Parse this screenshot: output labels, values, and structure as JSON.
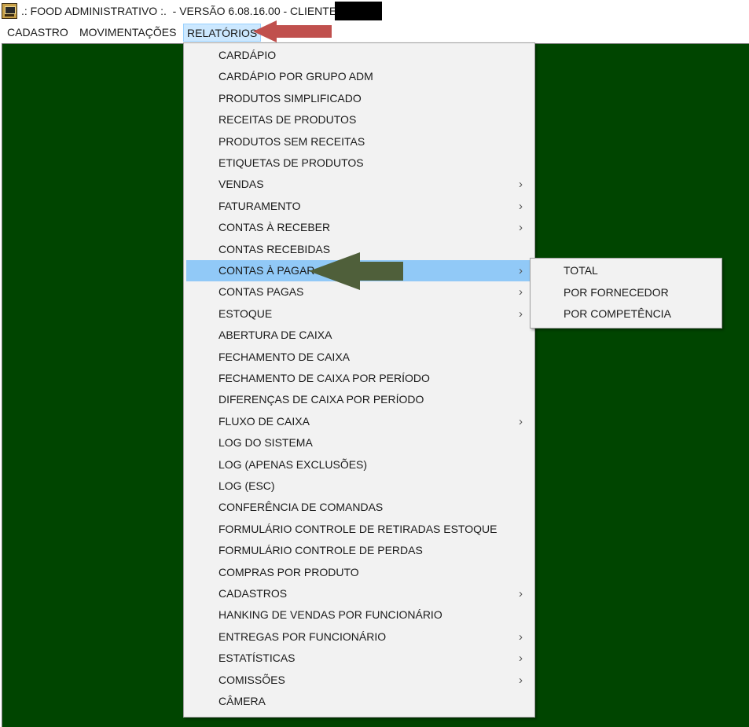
{
  "window": {
    "title": ".: FOOD ADMINISTRATIVO :.  - VERSÃO 6.08.16.00 - CLIENTE:"
  },
  "menubar": {
    "items": [
      "CADASTRO",
      "MOVIMENTAÇÕES",
      "RELATÓRIOS"
    ],
    "active": "RELATÓRIOS"
  },
  "relatorios_menu": {
    "items": [
      {
        "label": "CARDÁPIO"
      },
      {
        "label": "CARDÁPIO POR GRUPO ADM"
      },
      {
        "label": "PRODUTOS SIMPLIFICADO"
      },
      {
        "label": "RECEITAS DE PRODUTOS"
      },
      {
        "label": "PRODUTOS SEM RECEITAS"
      },
      {
        "label": "ETIQUETAS DE PRODUTOS"
      },
      {
        "label": "VENDAS",
        "submenu": true
      },
      {
        "label": "FATURAMENTO",
        "submenu": true
      },
      {
        "label": "CONTAS À RECEBER",
        "submenu": true
      },
      {
        "label": "CONTAS RECEBIDAS"
      },
      {
        "label": "CONTAS À PAGAR",
        "submenu": true,
        "highlighted": true
      },
      {
        "label": "CONTAS PAGAS",
        "submenu": true
      },
      {
        "label": "ESTOQUE",
        "submenu": true
      },
      {
        "label": "ABERTURA DE CAIXA"
      },
      {
        "label": "FECHAMENTO DE CAIXA"
      },
      {
        "label": "FECHAMENTO DE CAIXA POR PERÍODO"
      },
      {
        "label": "DIFERENÇAS DE CAIXA POR PERÍODO"
      },
      {
        "label": "FLUXO DE CAIXA",
        "submenu": true
      },
      {
        "label": "LOG DO SISTEMA"
      },
      {
        "label": "LOG (APENAS EXCLUSÕES)"
      },
      {
        "label": "LOG (ESC)"
      },
      {
        "label": "CONFERÊNCIA DE COMANDAS"
      },
      {
        "label": "FORMULÁRIO CONTROLE DE RETIRADAS ESTOQUE"
      },
      {
        "label": "FORMULÁRIO CONTROLE DE PERDAS"
      },
      {
        "label": "COMPRAS POR PRODUTO"
      },
      {
        "label": "CADASTROS",
        "submenu": true
      },
      {
        "label": "HANKING DE VENDAS POR FUNCIONÁRIO"
      },
      {
        "label": "ENTREGAS POR FUNCIONÁRIO",
        "submenu": true
      },
      {
        "label": "ESTATÍSTICAS",
        "submenu": true
      },
      {
        "label": "COMISSÕES",
        "submenu": true
      },
      {
        "label": "CÂMERA"
      }
    ]
  },
  "contas_pagar_submenu": {
    "items": [
      "TOTAL",
      "POR FORNECEDOR",
      "POR COMPETÊNCIA"
    ]
  },
  "colors": {
    "desktop": "#004500",
    "menu_bg": "#f2f2f2",
    "highlight": "#91c9f7",
    "red_arrow": "#c0504d",
    "green_arrow": "#4f5f3a"
  },
  "icons": {
    "app": "app-icon",
    "submenu": "chevron-right-icon"
  }
}
